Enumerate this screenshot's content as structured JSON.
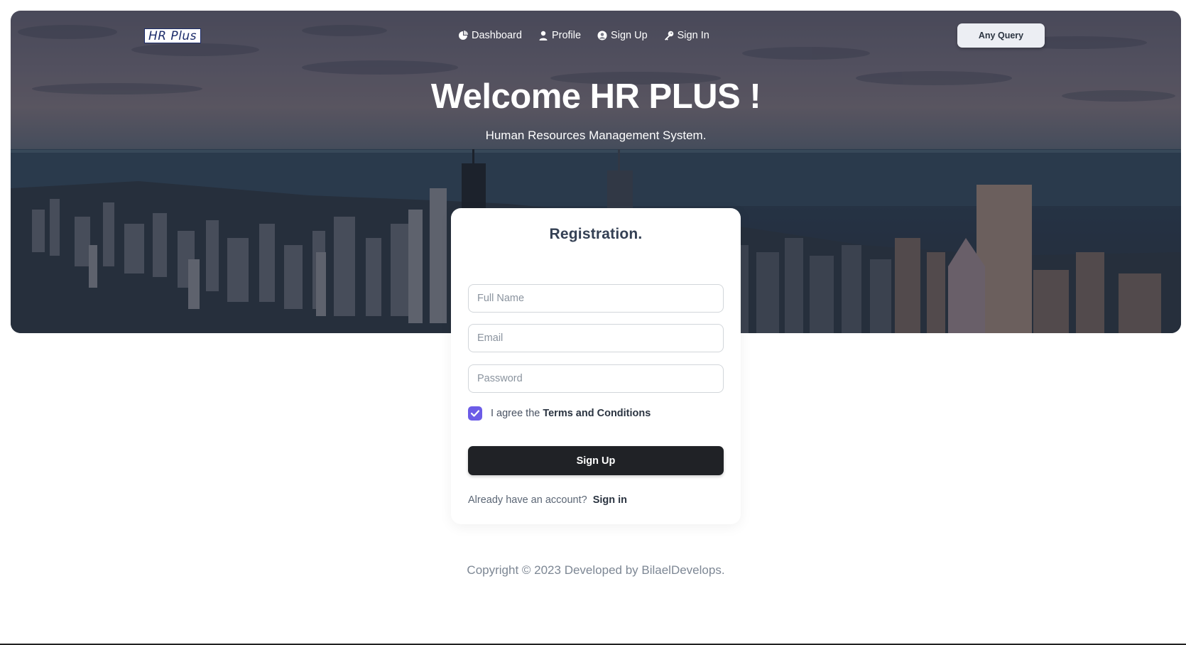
{
  "logo": {
    "text": "HR Plus"
  },
  "nav": {
    "items": [
      {
        "label": "Dashboard",
        "icon": "pie-chart-icon"
      },
      {
        "label": "Profile",
        "icon": "user-icon"
      },
      {
        "label": "Sign Up",
        "icon": "user-circle-icon"
      },
      {
        "label": "Sign In",
        "icon": "key-icon"
      }
    ],
    "query_button": "Any Query"
  },
  "hero": {
    "title": "Welcome HR PLUS !",
    "subtitle": "Human Resources Management System."
  },
  "form": {
    "title": "Registration.",
    "full_name_placeholder": "Full Name",
    "email_placeholder": "Email",
    "password_placeholder": "Password",
    "agree_text": "I agree the",
    "terms_link": "Terms and Conditions",
    "terms_checked": true,
    "submit_label": "Sign Up",
    "already_text": "Already have an account?",
    "signin_link": "Sign in"
  },
  "footer": {
    "copyright": "Copyright © 2023 Developed by BilaelDevelops."
  },
  "colors": {
    "accent_checkbox": "#6c5ce7",
    "button_dark": "#202226",
    "text_dark": "#344054"
  }
}
